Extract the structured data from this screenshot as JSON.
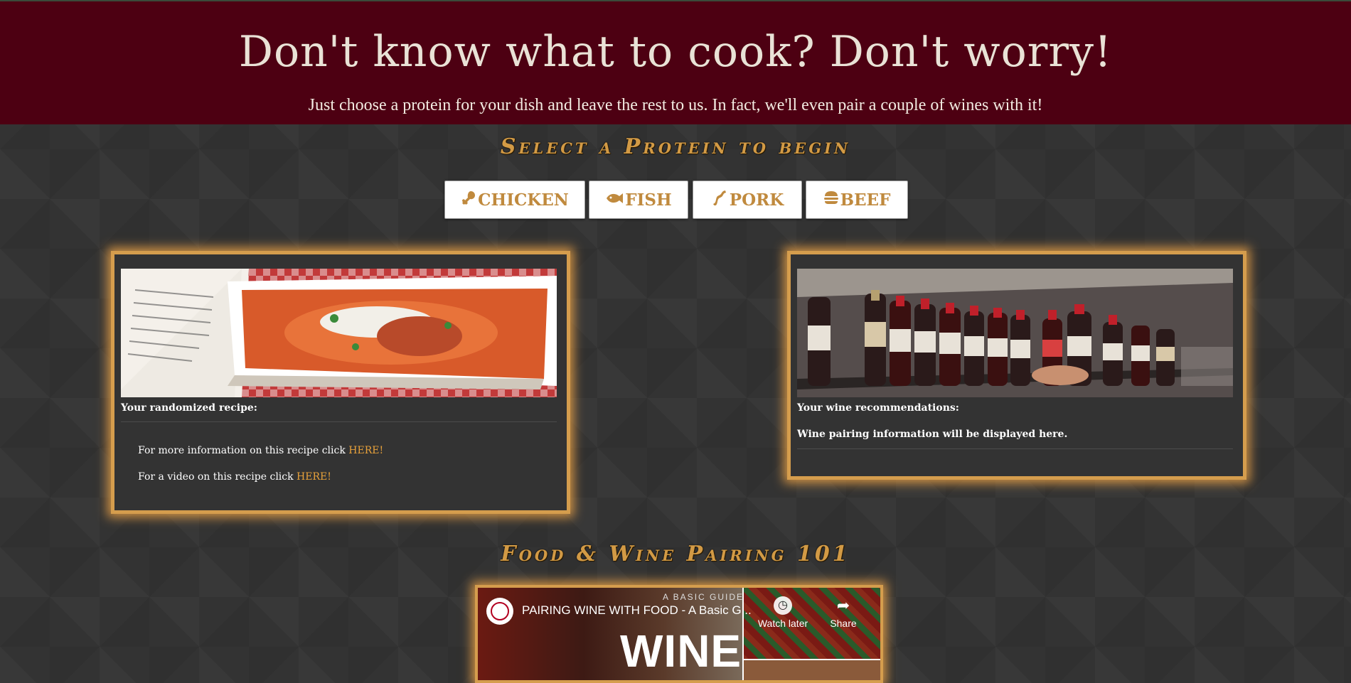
{
  "header": {
    "title": "Don't know what to cook? Don't worry!",
    "subtitle": "Just choose a protein for your dish and leave the rest to us. In fact, we'll even pair a couple of wines with it!"
  },
  "select_heading": "Select a Protein to begin",
  "proteins": [
    {
      "label": "CHICKEN",
      "icon": "drumstick-icon"
    },
    {
      "label": "FISH",
      "icon": "fish-icon"
    },
    {
      "label": "PORK",
      "icon": "bacon-icon"
    },
    {
      "label": "BEEF",
      "icon": "hamburger-icon"
    }
  ],
  "recipe_card": {
    "label": "Your randomized recipe:",
    "info_text": "For more information on this recipe click ",
    "info_link": "HERE!",
    "video_text": "For a video on this recipe click ",
    "video_link": "HERE!"
  },
  "wine_card": {
    "label": "Your wine recommendations:",
    "placeholder": "Wine pairing information will be displayed here."
  },
  "pairing_heading": "Food & Wine Pairing 101",
  "video": {
    "title": "PAIRING WINE WITH FOOD - A Basic G...",
    "guide_text": "A BASIC GUIDE",
    "overlay_word": "WINE",
    "watch_later": "Watch later",
    "share": "Share"
  },
  "colors": {
    "header_bg": "#4d0012",
    "accent": "#d59d4d",
    "link": "#e7a13b",
    "page_bg": "#333333"
  }
}
